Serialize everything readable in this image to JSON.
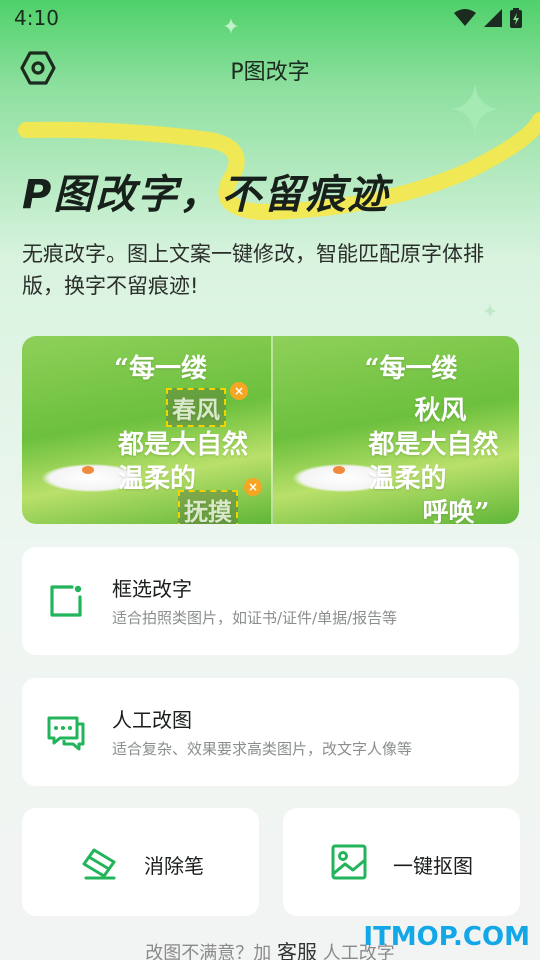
{
  "status_bar": {
    "time": "4:10"
  },
  "header": {
    "title": "P图改字"
  },
  "hero": {
    "title": "P图改字，不留痕迹",
    "description": "无痕改字。图上文案一键修改，智能匹配原字体排版，换字不留痕迹!"
  },
  "demo": {
    "before": {
      "line1": "“每一缕",
      "line2": "春风",
      "line3": "都是大自然",
      "line4": "温柔的",
      "line5": "抚摸"
    },
    "after": {
      "line1": "“每一缕",
      "line2": "秋风",
      "line3": "都是大自然",
      "line4": "温柔的",
      "line5": "呼唤”"
    },
    "close_glyph": "×"
  },
  "cards": [
    {
      "title": "框选改字",
      "subtitle": "适合拍照类图片，如证书/证件/单据/报告等",
      "icon": "crop-select-icon"
    },
    {
      "title": "人工改图",
      "subtitle": "适合复杂、效果要求高类图片，改文字人像等",
      "icon": "chat-icon"
    }
  ],
  "tools": [
    {
      "title": "消除笔",
      "icon": "eraser-icon"
    },
    {
      "title": "一键抠图",
      "icon": "image-icon"
    }
  ],
  "footer": {
    "prefix": "改图不满意？加",
    "link": "客服",
    "suffix": "人工改字"
  },
  "watermark": "ITMOP.COM",
  "colors": {
    "accent": "#22b45a",
    "highlight": "#f7e84a"
  }
}
